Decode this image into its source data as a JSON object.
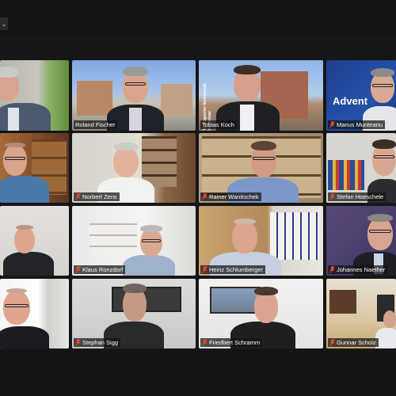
{
  "menu": {
    "icon": "chevron-down-icon",
    "glyph": "⌄"
  },
  "participants": [
    {
      "name": ""
    },
    {
      "name": "Roland Fischer"
    },
    {
      "name": "Tobias Koch"
    },
    {
      "name": "Manus Munteanu"
    },
    {
      "name": ""
    },
    {
      "name": "Norbert Zens"
    },
    {
      "name": "Rainer Wanitschek"
    },
    {
      "name": "Stefan Hoeschele"
    },
    {
      "name": ""
    },
    {
      "name": "Klaus Ronzdorf"
    },
    {
      "name": "Heinz Schlumberger"
    },
    {
      "name": "Johannes Naether"
    },
    {
      "name": ""
    },
    {
      "name": "Stephan Sigg"
    },
    {
      "name": "Friedbert Schramm"
    },
    {
      "name": "Gunnar Scholz"
    }
  ],
  "backgrounds": {
    "tobias_side_text": "Theologische Hochschule Friedensau",
    "manus_banner": "Advent"
  },
  "colors": {
    "active_speaker_border": "#cfd339",
    "mic_muted": "#e2473b",
    "app_background": "#161616"
  }
}
